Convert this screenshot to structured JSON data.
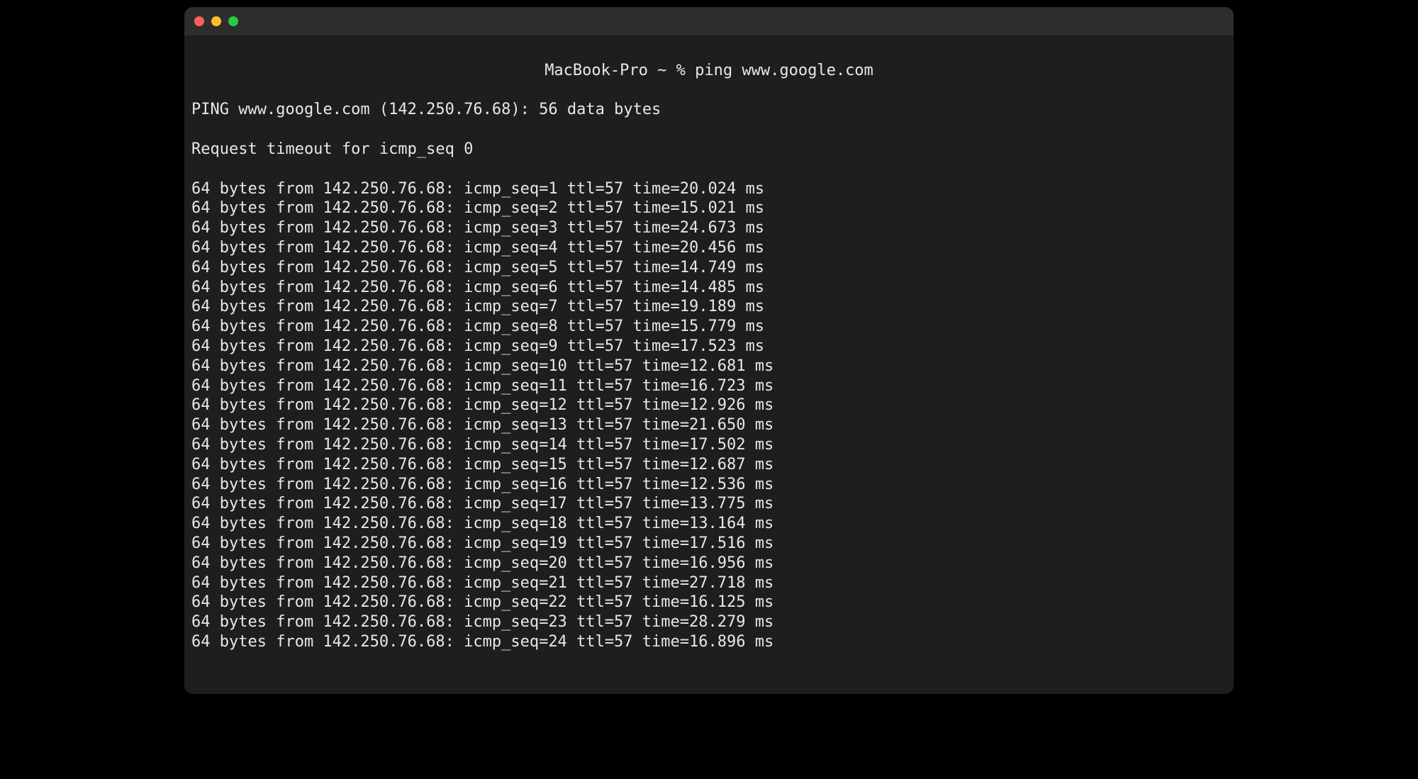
{
  "prompt": {
    "host": "MacBook-Pro",
    "cwd": "~",
    "symbol": "%",
    "command": "ping www.google.com"
  },
  "ping": {
    "header_host": "www.google.com",
    "header_ip": "142.250.76.68",
    "header_bytes": "56",
    "timeout_seq": "0",
    "reply_bytes": "64",
    "reply_ip": "142.250.76.68",
    "ttl": "57",
    "replies": [
      {
        "seq": "1",
        "time": "20.024"
      },
      {
        "seq": "2",
        "time": "15.021"
      },
      {
        "seq": "3",
        "time": "24.673"
      },
      {
        "seq": "4",
        "time": "20.456"
      },
      {
        "seq": "5",
        "time": "14.749"
      },
      {
        "seq": "6",
        "time": "14.485"
      },
      {
        "seq": "7",
        "time": "19.189"
      },
      {
        "seq": "8",
        "time": "15.779"
      },
      {
        "seq": "9",
        "time": "17.523"
      },
      {
        "seq": "10",
        "time": "12.681"
      },
      {
        "seq": "11",
        "time": "16.723"
      },
      {
        "seq": "12",
        "time": "12.926"
      },
      {
        "seq": "13",
        "time": "21.650"
      },
      {
        "seq": "14",
        "time": "17.502"
      },
      {
        "seq": "15",
        "time": "12.687"
      },
      {
        "seq": "16",
        "time": "12.536"
      },
      {
        "seq": "17",
        "time": "13.775"
      },
      {
        "seq": "18",
        "time": "13.164"
      },
      {
        "seq": "19",
        "time": "17.516"
      },
      {
        "seq": "20",
        "time": "16.956"
      },
      {
        "seq": "21",
        "time": "27.718"
      },
      {
        "seq": "22",
        "time": "16.125"
      },
      {
        "seq": "23",
        "time": "28.279"
      },
      {
        "seq": "24",
        "time": "16.896"
      }
    ]
  }
}
